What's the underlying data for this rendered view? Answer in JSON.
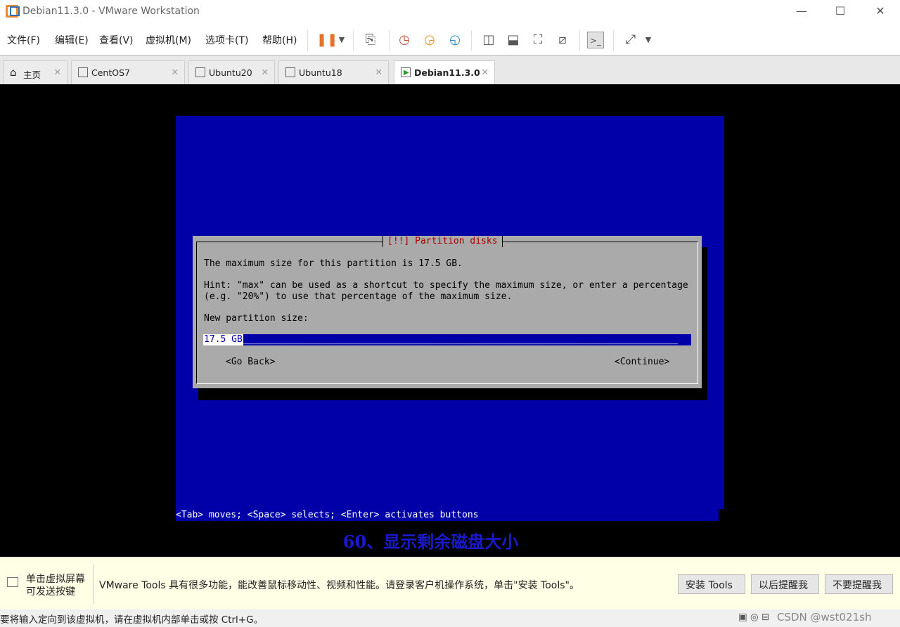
{
  "window": {
    "title": "Debian11.3.0 - VMware Workstation",
    "min": "—",
    "max": "☐",
    "close": "✕"
  },
  "menu": [
    "文件(F)",
    "编辑(E)",
    "查看(V)",
    "虚拟机(M)",
    "选项卡(T)",
    "帮助(H)"
  ],
  "tabs": [
    {
      "label": "主页",
      "icon": "home-icon"
    },
    {
      "label": "CentOS7",
      "icon": "vm-icon"
    },
    {
      "label": "Ubuntu20",
      "icon": "vm-icon"
    },
    {
      "label": "Ubuntu18",
      "icon": "vm-icon"
    },
    {
      "label": "Debian11.3.0",
      "icon": "vm-running-icon",
      "active": true
    }
  ],
  "tab_close": "✕",
  "dialog": {
    "title": "[!!] Partition disks",
    "line1": "The maximum size for this partition is 17.5 GB.",
    "line2": "Hint: \"max\" can be used as a shortcut to specify the maximum size, or enter a percentage",
    "line3": "(e.g. \"20%\") to use that percentage of the maximum size.",
    "prompt": "New partition size:",
    "value": "17.5 GB",
    "back": "<Go Back>",
    "continue": "<Continue>"
  },
  "hint": "<Tab> moves; <Space> selects; <Enter> activates buttons",
  "caption": "60、显示剩余磁盘大小",
  "notification": {
    "left1": "单击虚拟屏幕",
    "left2": "可发送按键",
    "message": "VMware Tools 具有很多功能，能改善鼠标移动性、视频和性能。请登录客户机操作系统，单击\"安装 Tools\"。",
    "install": "安装 Tools",
    "later": "以后提醒我",
    "never": "不要提醒我"
  },
  "status": {
    "text": "要将输入定向到该虚拟机，请在虚拟机内部单击或按 Ctrl+G。",
    "watermark": "CSDN @wst021sh"
  },
  "colors": {
    "vm_blue": "#0000a8",
    "dialog_gray": "#aaaaaa",
    "title_red": "#a80000",
    "pause_orange": "#e8702a"
  }
}
